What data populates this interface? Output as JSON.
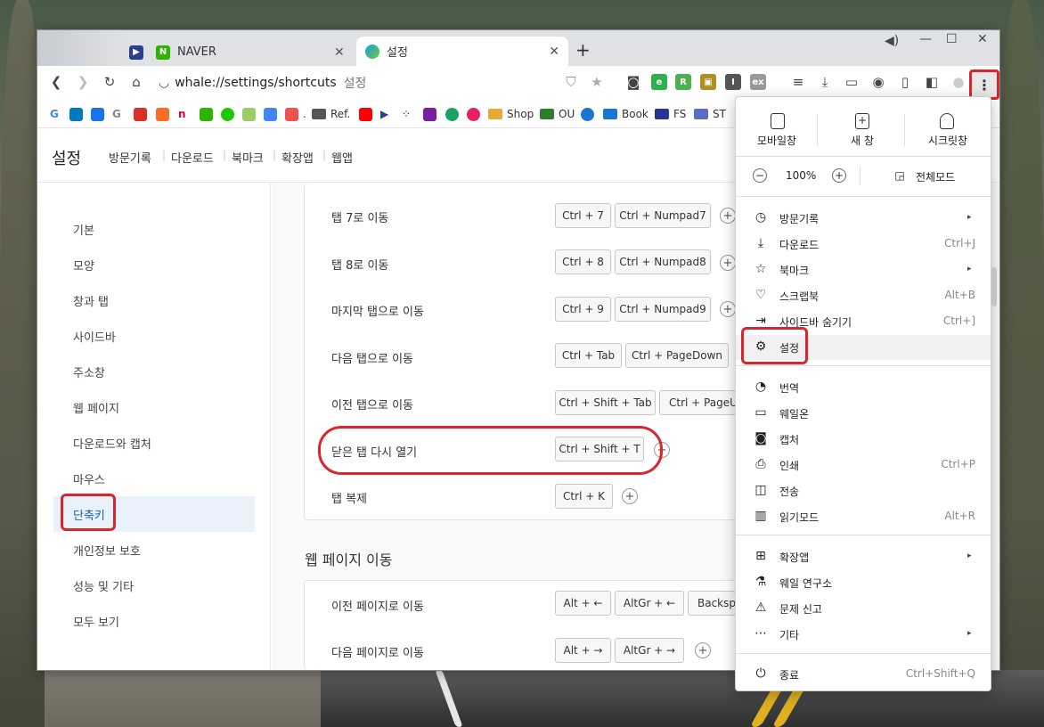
{
  "tabs": [
    {
      "label": "NAVER"
    },
    {
      "label": "설정"
    }
  ],
  "address": {
    "url": "whale://settings/shortcuts",
    "page_title": "설정"
  },
  "bookmarks": [
    "Ref.",
    "Shop",
    "OU",
    "Book",
    "FS",
    "ST"
  ],
  "settings": {
    "title": "설정",
    "subnav": [
      "방문기록",
      "다운로드",
      "북마크",
      "확장앱",
      "웹앱"
    ]
  },
  "leftnav": [
    "기본",
    "모양",
    "창과 탭",
    "사이드바",
    "주소창",
    "웹 페이지",
    "다운로드와 캡처",
    "마우스",
    "단축키",
    "개인정보 보호",
    "성능 및 기타",
    "모두 보기"
  ],
  "shortcut_rows": [
    {
      "label": "탭 7로 이동",
      "keys": [
        "Ctrl + 7",
        "Ctrl + Numpad7"
      ]
    },
    {
      "label": "탭 8로 이동",
      "keys": [
        "Ctrl + 8",
        "Ctrl + Numpad8"
      ]
    },
    {
      "label": "마지막 탭으로 이동",
      "keys": [
        "Ctrl + 9",
        "Ctrl + Numpad9"
      ]
    },
    {
      "label": "다음 탭으로 이동",
      "keys": [
        "Ctrl + Tab",
        "Ctrl + PageDown"
      ]
    },
    {
      "label": "이전 탭으로 이동",
      "keys": [
        "Ctrl + Shift + Tab",
        "Ctrl + PageUp"
      ]
    },
    {
      "label": "닫은 탭 다시 열기",
      "keys": [
        "Ctrl + Shift + T"
      ]
    },
    {
      "label": "탭 복제",
      "keys": [
        "Ctrl + K"
      ]
    }
  ],
  "section2": {
    "title": "웹 페이지 이동",
    "rows": [
      {
        "label": "이전 페이지로 이동",
        "keys": [
          "Alt + ←",
          "AltGr + ←",
          "Backsp"
        ]
      },
      {
        "label": "다음 페이지로 이동",
        "keys": [
          "Alt + →",
          "AltGr + →"
        ]
      }
    ]
  },
  "menu": {
    "top": [
      {
        "label": "모바일창",
        "icon": "mobile-icon"
      },
      {
        "label": "새 창",
        "icon": "new-window-icon"
      },
      {
        "label": "시크릿창",
        "icon": "secret-window-icon"
      }
    ],
    "zoom": {
      "value": "100%",
      "fullscreen": "전체모드"
    },
    "items1": [
      {
        "label": "방문기록",
        "shortcut": "",
        "icon": "history-icon",
        "submenu": true
      },
      {
        "label": "다운로드",
        "shortcut": "Ctrl+J",
        "icon": "download-icon",
        "submenu": false
      },
      {
        "label": "북마크",
        "shortcut": "",
        "icon": "star-icon",
        "submenu": true
      },
      {
        "label": "스크랩북",
        "shortcut": "Alt+B",
        "icon": "scrapbook-icon",
        "submenu": false
      },
      {
        "label": "사이드바 숨기기",
        "shortcut": "Ctrl+]",
        "icon": "sidebar-icon",
        "submenu": false
      },
      {
        "label": "설정",
        "shortcut": "",
        "icon": "gear-icon",
        "submenu": false
      }
    ],
    "items2": [
      {
        "label": "번역",
        "shortcut": "",
        "icon": "translate-icon"
      },
      {
        "label": "웨일온",
        "shortcut": "",
        "icon": "video-icon"
      },
      {
        "label": "캡처",
        "shortcut": "",
        "icon": "camera-icon"
      },
      {
        "label": "인쇄",
        "shortcut": "Ctrl+P",
        "icon": "print-icon"
      },
      {
        "label": "전송",
        "shortcut": "",
        "icon": "cast-icon"
      },
      {
        "label": "읽기모드",
        "shortcut": "Alt+R",
        "icon": "book-icon"
      }
    ],
    "items3": [
      {
        "label": "확장앱",
        "icon": "extensions-icon",
        "submenu": true
      },
      {
        "label": "웨일 연구소",
        "icon": "flask-icon",
        "submenu": false
      },
      {
        "label": "문제 신고",
        "icon": "report-icon",
        "submenu": false
      },
      {
        "label": "기타",
        "icon": "more-icon",
        "submenu": true
      }
    ],
    "exit": {
      "label": "종료",
      "shortcut": "Ctrl+Shift+Q",
      "icon": "power-icon"
    }
  },
  "colors": {
    "highlight_red": "#d8262e",
    "active_nav": "#e9f2fb"
  }
}
